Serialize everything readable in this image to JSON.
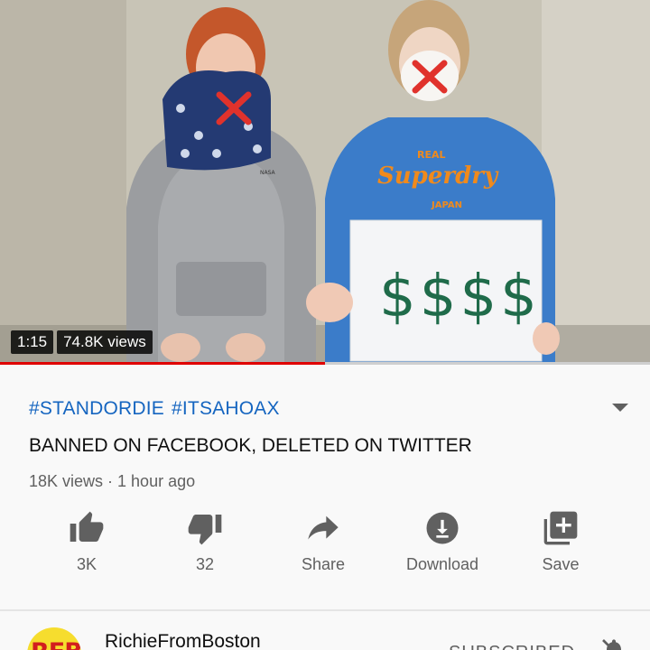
{
  "player": {
    "timestamp": "1:15",
    "views_badge": "74.8K views",
    "progress": 0.5,
    "sign_text": "$$$$",
    "shirt_text_1": "REAL",
    "shirt_text_2": "Superdry",
    "shirt_text_3": "JAPAN",
    "sweatshirt_logo": "NASA"
  },
  "video": {
    "hashtags": [
      "#STANDORDIE",
      "#ITSAHOAX"
    ],
    "title": "BANNED ON FACEBOOK, DELETED ON TWITTER",
    "meta": "18K views · 1 hour ago"
  },
  "actions": {
    "like": {
      "label": "3K",
      "icon": "thumbs-up-icon"
    },
    "dislike": {
      "label": "32",
      "icon": "thumbs-down-icon"
    },
    "share": {
      "label": "Share",
      "icon": "share-icon"
    },
    "download": {
      "label": "Download",
      "icon": "download-icon"
    },
    "save": {
      "label": "Save",
      "icon": "playlist-add-icon"
    }
  },
  "channel": {
    "name": "RichieFromBoston",
    "avatar_text": "RFB",
    "subscribe_label": "SUBSCRIBED"
  },
  "colors": {
    "accent_link": "#1565c0",
    "progress_red": "#e00000",
    "icon_gray": "#606060"
  }
}
